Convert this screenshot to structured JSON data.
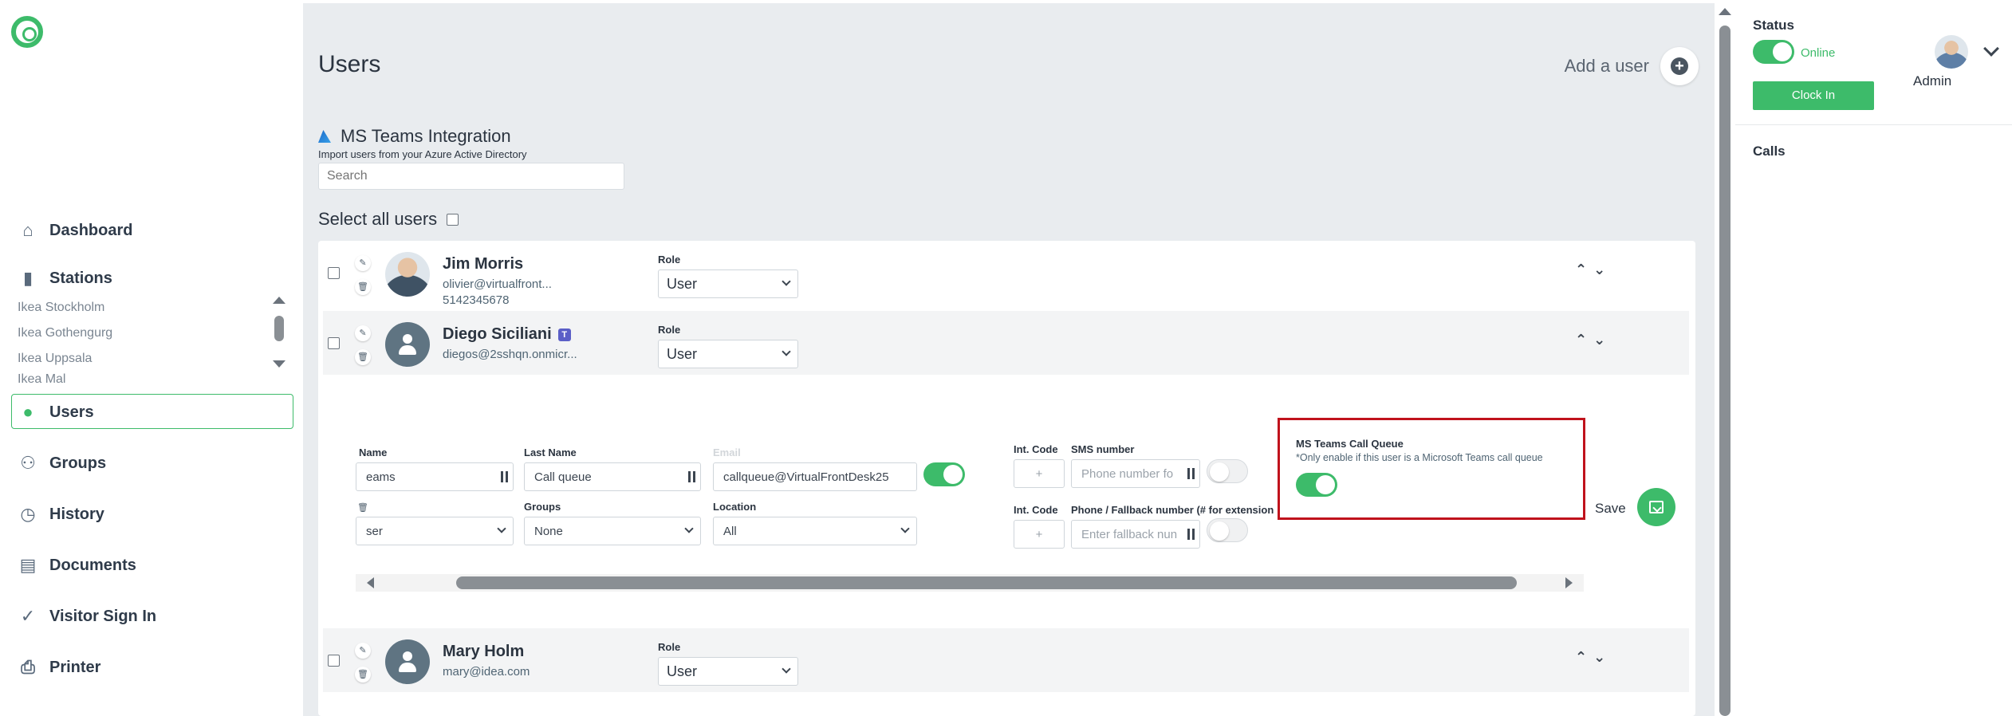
{
  "sidebar": {
    "nav": {
      "dashboard": "Dashboard",
      "stations": "Stations",
      "users": "Users",
      "groups": "Groups",
      "history": "History",
      "documents": "Documents",
      "visitor_sign_in": "Visitor Sign In",
      "printer": "Printer"
    },
    "stations": [
      "Ikea Stockholm",
      "Ikea Gothengurg",
      "Ikea Uppsala",
      "Ikea Mal"
    ]
  },
  "main": {
    "title": "Users",
    "add_user": "Add a user",
    "ms_title": "MS Teams Integration",
    "ms_subtitle": "Import users from your Azure Active Directory",
    "search_placeholder": "Search",
    "select_all": "Select all users",
    "role_label": "Role",
    "users": [
      {
        "name": "Jim Morris",
        "email": "olivier@virtualfront...",
        "phone": "5142345678",
        "role": "User"
      },
      {
        "name": "Diego Siciliani",
        "email": "diegos@2sshqn.onmicr...",
        "role": "User"
      },
      {
        "name": "Mary Holm",
        "email": "mary@idea.com",
        "role": "User"
      }
    ],
    "form": {
      "name_label": "Name",
      "name_value": "eams",
      "last_name_label": "Last Name",
      "last_name_value": "Call queue",
      "email_label": "Email",
      "email_value": "callqueue@VirtualFrontDesk25",
      "int_code_label": "Int. Code",
      "int_code_placeholder": "+",
      "sms_label": "SMS number",
      "sms_placeholder": "Phone number fo",
      "fallback_label": "Phone / Fallback number (# for extension",
      "fallback_placeholder": "Enter fallback nun",
      "role_value": "ser",
      "groups_label": "Groups",
      "groups_value": "None",
      "location_label": "Location",
      "location_value": "All",
      "teams_queue_label": "MS Teams Call Queue",
      "teams_queue_note": "*Only enable if this user is a Microsoft Teams call queue",
      "save": "Save"
    }
  },
  "right": {
    "status_label": "Status",
    "status_value": "Online",
    "clock_in": "Clock In",
    "admin": "Admin",
    "calls": "Calls"
  },
  "colors": {
    "accent": "#3dbb6a",
    "highlight_border": "#c0121c",
    "main_bg": "#e9ecef"
  }
}
